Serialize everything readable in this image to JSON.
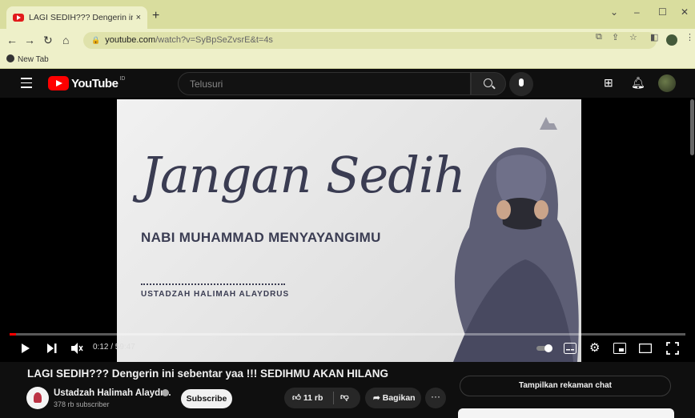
{
  "browser": {
    "tab_title": "LAGI SEDIH??? Dengerin ini sebe",
    "tab_close": "×",
    "new_tab": "+",
    "url_host": "youtube.com",
    "url_path": "/watch?v=SyBpSeZvsrE&t=4s",
    "bookmark_label": "New Tab"
  },
  "youtube": {
    "logo_text": "YouTube",
    "region": "ID",
    "search_placeholder": "Telusuri"
  },
  "video": {
    "overlay_script": "Jangan Sedih",
    "overlay_subhead": "NABI MUHAMMAD MENYAYANGIMU",
    "overlay_speaker": "USTADZAH HALIMAH ALAYDRUS",
    "time": "0:12 / 59:47",
    "progress": 0.003
  },
  "info": {
    "title": "LAGI SEDIH??? Dengerin ini sebentar yaa !!! SEDIHMU AKAN HILANG",
    "channel": "Ustadzah Halimah Alaydr...",
    "subscribers": "378 rb subscriber",
    "subscribe_label": "Subscribe",
    "like_count": "11 rb",
    "share_label": "Bagikan",
    "chat_label": "Tampilkan rekaman chat"
  },
  "colors": {
    "chrome_tabbar": "#d9dd9e",
    "chrome_toolbar": "#eef0c9",
    "yt_bg": "#0f0f0f",
    "yt_red": "#ff0000"
  }
}
